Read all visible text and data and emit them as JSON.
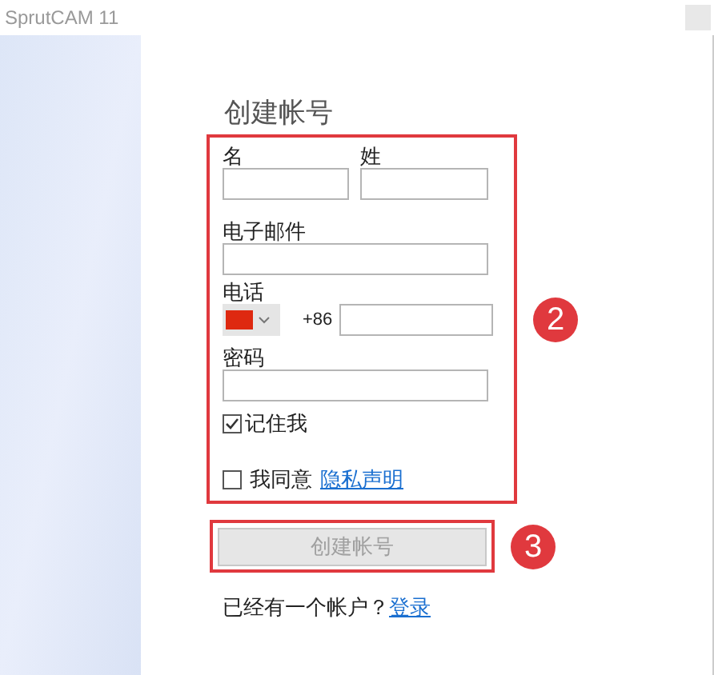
{
  "window": {
    "title": "SprutCAM 11"
  },
  "heading": "创建帐号",
  "form": {
    "first_name": {
      "label": "名"
    },
    "last_name": {
      "label": "姓"
    },
    "email": {
      "label": "电子邮件"
    },
    "phone": {
      "label": "电话",
      "country_code": "+86"
    },
    "password": {
      "label": "密码"
    },
    "remember": {
      "label": "记住我",
      "checked": true
    },
    "agree": {
      "label": "我同意",
      "link": "隐私声明",
      "checked": false
    }
  },
  "create_button": {
    "label": "创建帐号",
    "disabled": true
  },
  "login_prompt": {
    "text": "已经有一个帐户？",
    "link": "登录"
  },
  "annotations": [
    {
      "label": "2"
    },
    {
      "label": "3"
    }
  ]
}
